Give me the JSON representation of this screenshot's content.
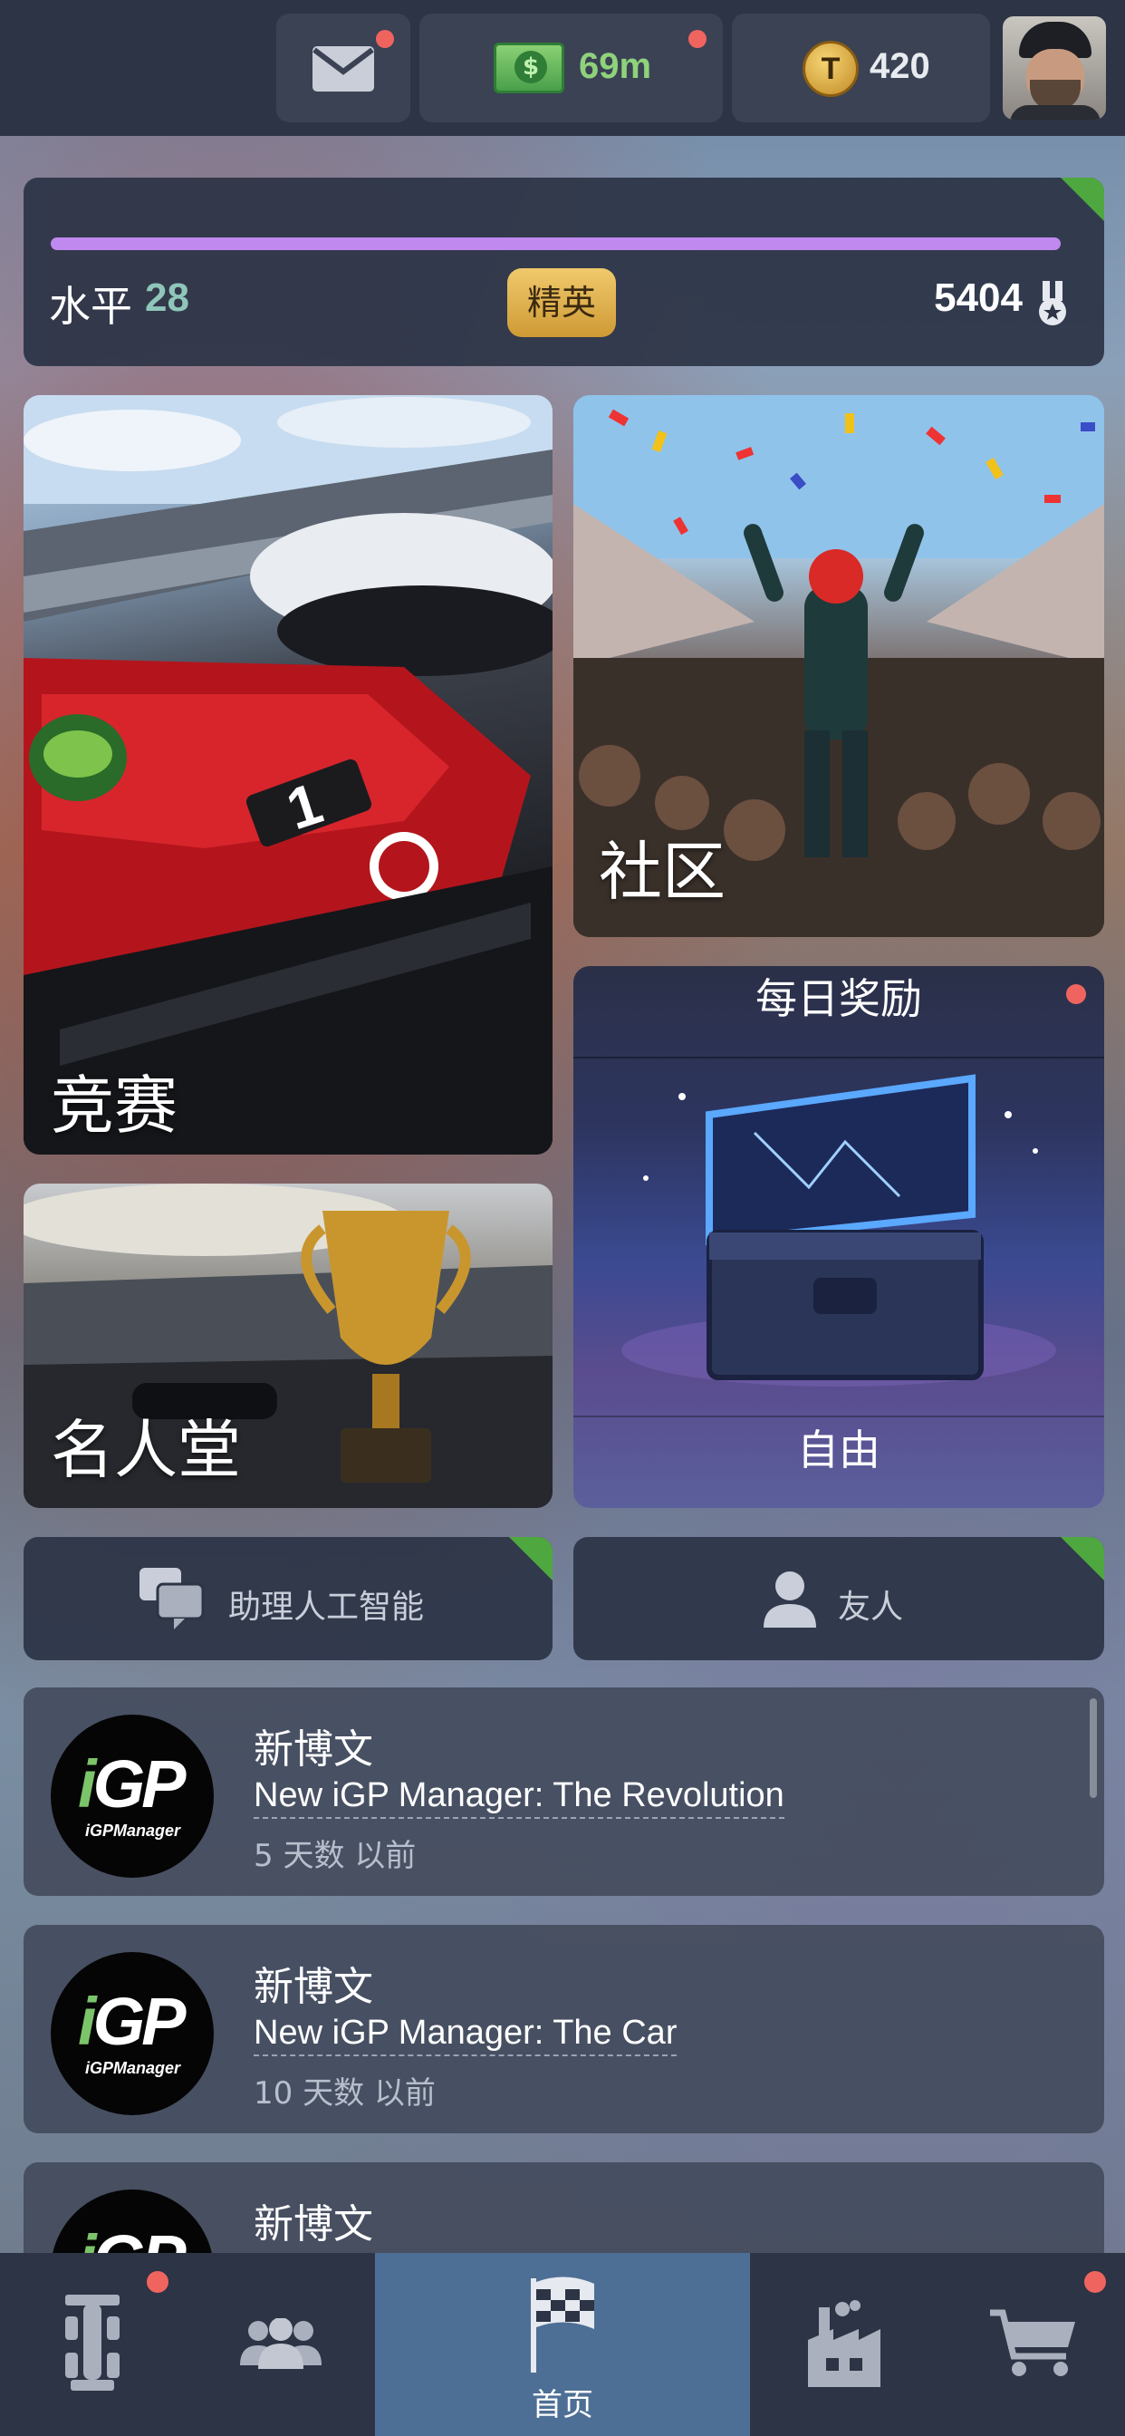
{
  "topbar": {
    "cash": "69m",
    "tokens": "420",
    "token_letter": "T",
    "cash_symbol": "$",
    "icons": [
      "mail-icon",
      "cash-icon",
      "token-icon",
      "avatar"
    ]
  },
  "level": {
    "label": "水平",
    "value": "28",
    "tier": "精英",
    "points": "5404",
    "progress": 0.99
  },
  "tiles": {
    "race": "竞赛",
    "community": "社区",
    "daily_title": "每日奖励",
    "daily_footer": "自由",
    "hall": "名人堂"
  },
  "buttons": {
    "ai": "助理人工智能",
    "friends": "友人"
  },
  "news": [
    {
      "heading": "新博文",
      "title": "New iGP Manager: The Revolution",
      "ago": "5 天数 以前"
    },
    {
      "heading": "新博文",
      "title": "New iGP Manager: The Car",
      "ago": "10 天数 以前"
    },
    {
      "heading": "新博文"
    }
  ],
  "logo": {
    "main": "GP",
    "prefix": "i",
    "sub": "iGPManager"
  },
  "nav": {
    "home": "首页",
    "icons": [
      "car-icon",
      "team-icon",
      "flag-icon",
      "factory-icon",
      "cart-icon"
    ]
  },
  "colors": {
    "accent": "#4ea83f",
    "notify": "#f0645f",
    "progress": "#c089ef",
    "gold": "#e7b553"
  }
}
